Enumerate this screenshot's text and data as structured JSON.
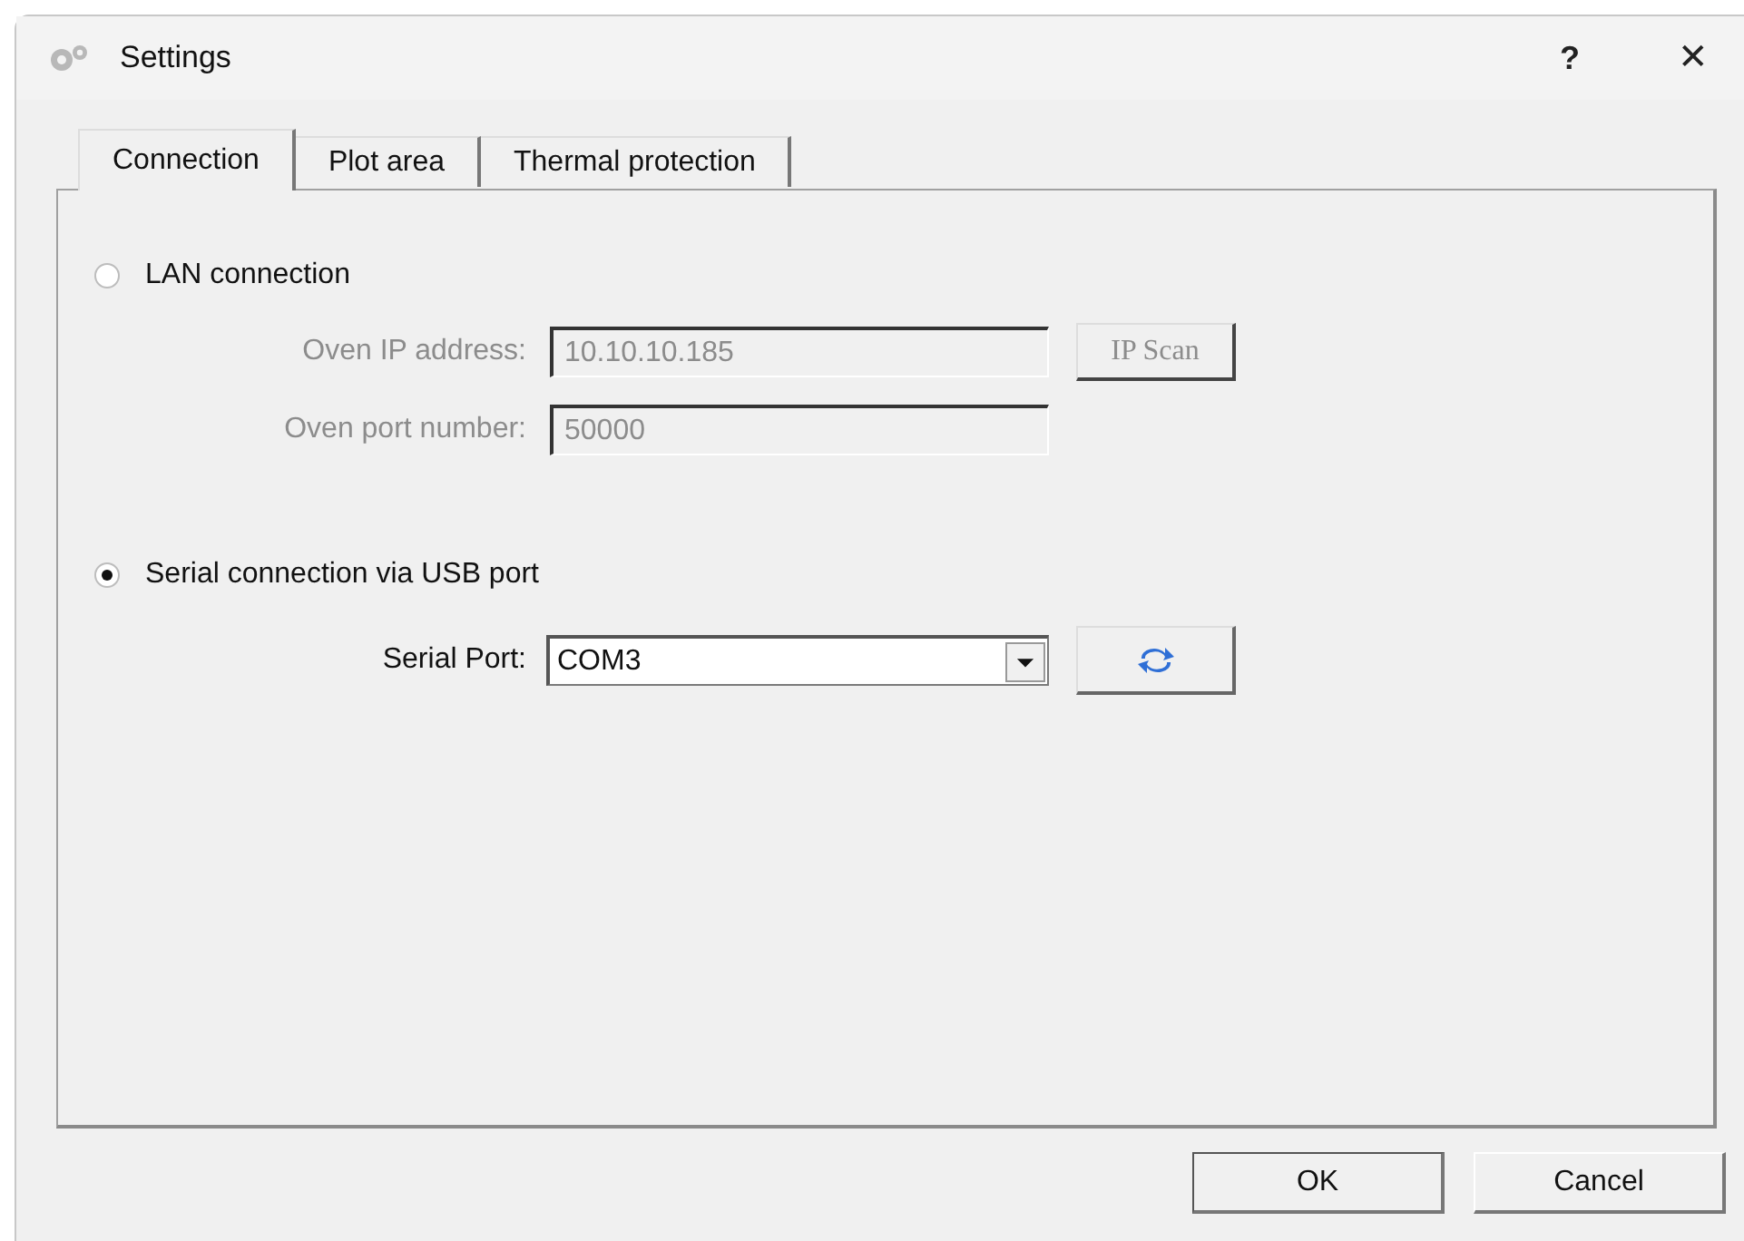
{
  "window": {
    "title": "Settings",
    "help": "?",
    "close": "✕"
  },
  "tabs": [
    {
      "label": "Connection",
      "selected": true
    },
    {
      "label": "Plot area",
      "selected": false
    },
    {
      "label": "Thermal protection",
      "selected": false
    }
  ],
  "lan": {
    "label": "LAN connection",
    "selected": false,
    "fields": [
      {
        "label": "Oven IP address:",
        "value": "10.10.10.185",
        "disabled": true
      },
      {
        "label": "Oven port number:",
        "value": "50000",
        "disabled": true
      }
    ],
    "scan_button": {
      "label": "IP Scan",
      "disabled": true
    }
  },
  "serial": {
    "label": "Serial connection via USB port",
    "selected": true,
    "port": {
      "label": "Serial Port:",
      "value": "COM3"
    }
  },
  "buttons": [
    {
      "label": "OK",
      "default": true
    },
    {
      "label": "Cancel",
      "default": false
    }
  ]
}
